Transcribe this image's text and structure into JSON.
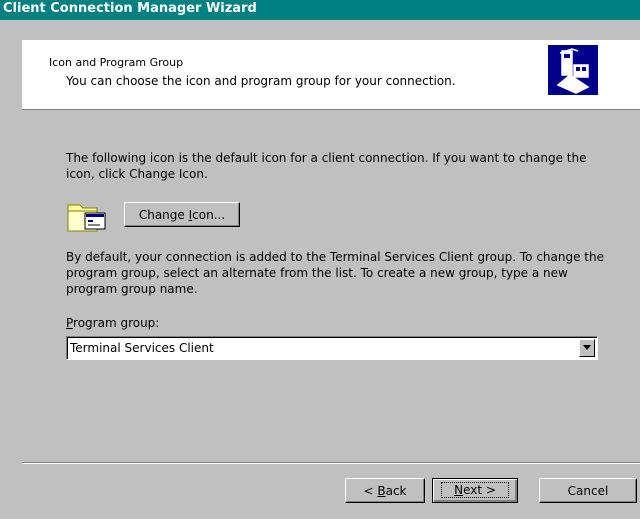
{
  "window": {
    "title": "Client Connection Manager Wizard"
  },
  "header": {
    "title": "Icon and Program Group",
    "subtitle": "You can choose the icon and program group for your connection.",
    "icon": "network-computers-icon"
  },
  "icon_section": {
    "description": "The following icon is the default icon for a client connection. If you want to change the icon, click Change Icon.",
    "change_button_pre": "Change ",
    "change_button_mnemonic": "I",
    "change_button_post": "con...",
    "icon": "folder-window-icon"
  },
  "group_section": {
    "description": "By default, your connection is added to the Terminal Services Client group. To change the program group, select an alternate from the list. To create a new group, type a new program group name.",
    "label_mnemonic": "P",
    "label_rest": "rogram group:",
    "selected_value": "Terminal Services Client"
  },
  "footer": {
    "back_pre": "< ",
    "back_mnemonic": "B",
    "back_post": "ack",
    "next_mnemonic": "N",
    "next_post": "ext >",
    "cancel_label": "Cancel"
  },
  "colors": {
    "titlebar": "#008080",
    "dialog_bg": "#c0c0c0",
    "banner_icon_bg": "#00008b"
  }
}
